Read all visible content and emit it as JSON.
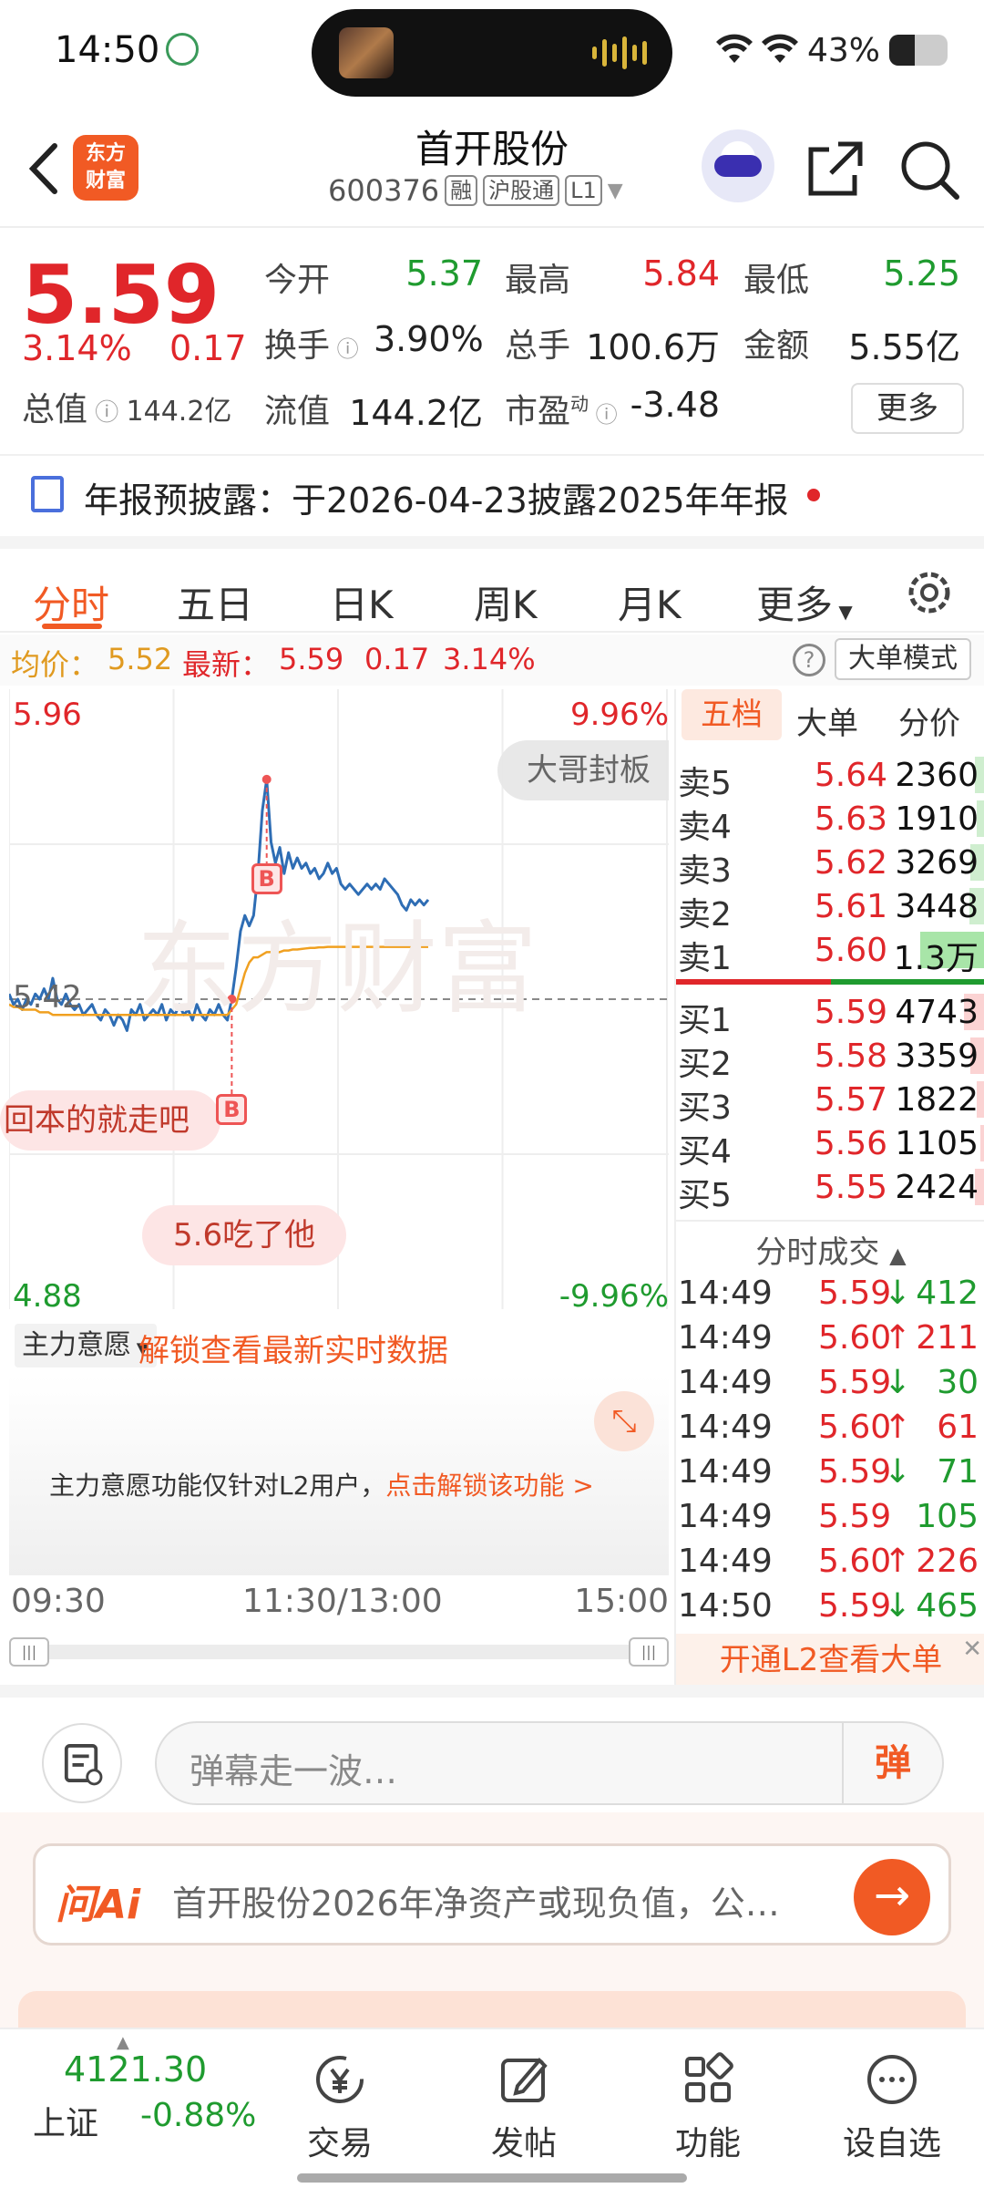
{
  "status_bar": {
    "time": "14:50",
    "battery": "43%",
    "battery_level": 0.43
  },
  "header": {
    "stock_name": "首开股份",
    "stock_code": "600376",
    "tags": [
      "融",
      "沪股通",
      "L1"
    ],
    "logo_text_line1": "东方",
    "logo_text_line2": "财富"
  },
  "quote": {
    "price": "5.59",
    "change_pct": "3.14%",
    "change": "0.17",
    "market_cap_label": "总值",
    "market_cap": "144.2亿",
    "open_label": "今开",
    "open": "5.37",
    "high_label": "最高",
    "high": "5.84",
    "low_label": "最低",
    "low": "5.25",
    "turnover_label": "换手",
    "turnover": "3.90%",
    "volume_label": "总手",
    "volume": "100.6万",
    "amount_label": "金额",
    "amount": "5.55亿",
    "float_cap_label": "流值",
    "float_cap": "144.2亿",
    "pe_label": "市盈",
    "pe_sup": "动",
    "pe": "-3.48",
    "more_label": "更多"
  },
  "notice": {
    "text": "年报预披露：于2026-04-23披露2025年年报"
  },
  "tabs": [
    "分时",
    "五日",
    "日K",
    "周K",
    "月K",
    "更多"
  ],
  "avg_row": {
    "avg_label": "均价：",
    "avg": "5.52",
    "last_label": "最新：",
    "last": "5.59",
    "chg": "0.17",
    "pct": "3.14%",
    "big_mode_label": "大单模式"
  },
  "chart_data": {
    "type": "line",
    "title": "",
    "ylim": [
      4.88,
      5.96
    ],
    "y_tick_labels": {
      "top": "5.96",
      "mid": "5.42",
      "bottom": "4.88"
    },
    "pct_tick_labels": {
      "top": "9.96%",
      "bottom": "-9.96%"
    },
    "prev_close": 5.42,
    "x_tick_labels": [
      "09:30",
      "11:30/13:00",
      "15:00"
    ],
    "series": [
      {
        "values": [
          5.43,
          5.41,
          5.42,
          5.4,
          5.42,
          5.41,
          5.43,
          5.42,
          5.44,
          5.42,
          5.46,
          5.42,
          5.41,
          5.43,
          5.41,
          5.4,
          5.41,
          5.39,
          5.4,
          5.41,
          5.39,
          5.38,
          5.4,
          5.39,
          5.37,
          5.39,
          5.38,
          5.36,
          5.4,
          5.39,
          5.41,
          5.38,
          5.39,
          5.4,
          5.39,
          5.41,
          5.38,
          5.4,
          5.39,
          5.41,
          5.39,
          5.4,
          5.38,
          5.41,
          5.39,
          5.38,
          5.4,
          5.39,
          5.41,
          5.39,
          5.38,
          5.42,
          5.48,
          5.55,
          5.58,
          5.56,
          5.58,
          5.66,
          5.78,
          5.84,
          5.72,
          5.68,
          5.71,
          5.66,
          5.7,
          5.67,
          5.69,
          5.67,
          5.68,
          5.66,
          5.67,
          5.65,
          5.66,
          5.68,
          5.66,
          5.67,
          5.64,
          5.63,
          5.64,
          5.63,
          5.62,
          5.63,
          5.64,
          5.63,
          5.64,
          5.63,
          5.65,
          5.64,
          5.63,
          5.62,
          5.6,
          5.59,
          5.61,
          5.6,
          5.61,
          5.6,
          5.61
        ]
      },
      {
        "values": [
          5.41,
          5.405,
          5.405,
          5.4,
          5.4,
          5.4,
          5.4,
          5.395,
          5.395,
          5.395,
          5.39,
          5.39,
          5.39,
          5.39,
          5.39,
          5.39,
          5.39,
          5.39,
          5.39,
          5.39,
          5.39,
          5.39,
          5.39,
          5.39,
          5.39,
          5.39,
          5.39,
          5.39,
          5.39,
          5.39,
          5.39,
          5.39,
          5.39,
          5.39,
          5.39,
          5.39,
          5.39,
          5.39,
          5.39,
          5.39,
          5.39,
          5.39,
          5.39,
          5.39,
          5.39,
          5.39,
          5.39,
          5.39,
          5.39,
          5.39,
          5.39,
          5.4,
          5.41,
          5.44,
          5.47,
          5.49,
          5.5,
          5.5,
          5.505,
          5.51,
          5.51,
          5.51,
          5.51,
          5.513,
          5.513,
          5.515,
          5.515,
          5.516,
          5.517,
          5.518,
          5.518,
          5.519,
          5.519,
          5.52,
          5.52,
          5.52,
          5.52,
          5.52,
          5.52,
          5.52,
          5.52,
          5.52,
          5.52,
          5.52,
          5.52,
          5.52,
          5.52,
          5.52,
          5.52,
          5.52,
          5.52,
          5.52,
          5.52,
          5.52,
          5.52,
          5.52,
          5.52
        ]
      }
    ],
    "colors": {
      "price": "#2e6db4",
      "average": "#f0a020"
    }
  },
  "danmu": [
    "大哥封板",
    "回本的就走吧",
    "5.6吃了他"
  ],
  "trade_marks": [
    "B",
    "B"
  ],
  "main_force": {
    "select_label": "主力意愿",
    "unlock_text": "解锁查看最新实时数据",
    "msg": "主力意愿功能仅针对L2用户，",
    "msg_link": "点击解锁该功能 >"
  },
  "order_book": {
    "tabs": [
      "五档",
      "大单",
      "分价"
    ],
    "asks": [
      {
        "label": "卖5",
        "price": "5.64",
        "vol": "2360",
        "bar": 0.1
      },
      {
        "label": "卖4",
        "price": "5.63",
        "vol": "1910",
        "bar": 0.08
      },
      {
        "label": "卖3",
        "price": "5.62",
        "vol": "3269",
        "bar": 0.14
      },
      {
        "label": "卖2",
        "price": "5.61",
        "vol": "3448",
        "bar": 0.15
      },
      {
        "label": "卖1",
        "price": "5.60",
        "vol": "1.3万",
        "bar": 0.6
      }
    ],
    "bids": [
      {
        "label": "买1",
        "price": "5.59",
        "vol": "4743",
        "bar": 0.2
      },
      {
        "label": "买2",
        "price": "5.58",
        "vol": "3359",
        "bar": 0.14
      },
      {
        "label": "买3",
        "price": "5.57",
        "vol": "1822",
        "bar": 0.08
      },
      {
        "label": "买4",
        "price": "5.56",
        "vol": "1105",
        "bar": 0.05
      },
      {
        "label": "买5",
        "price": "5.55",
        "vol": "2424",
        "bar": 0.1
      }
    ],
    "ticks_title": "分时成交",
    "ticks": [
      {
        "time": "14:49",
        "price": "5.59",
        "dir": "↓",
        "vol": "412"
      },
      {
        "time": "14:49",
        "price": "5.60",
        "dir": "↑",
        "vol": "211"
      },
      {
        "time": "14:49",
        "price": "5.59",
        "dir": "↓",
        "vol": "30"
      },
      {
        "time": "14:49",
        "price": "5.60",
        "dir": "↑",
        "vol": "61"
      },
      {
        "time": "14:49",
        "price": "5.59",
        "dir": "↓",
        "vol": "71"
      },
      {
        "time": "14:49",
        "price": "5.59",
        "dir": "",
        "vol": "105"
      },
      {
        "time": "14:49",
        "price": "5.60",
        "dir": "↑",
        "vol": "226"
      },
      {
        "time": "14:50",
        "price": "5.59",
        "dir": "↓",
        "vol": "465"
      }
    ],
    "l2_banner": "开通L2查看大单"
  },
  "comment": {
    "placeholder": "弹幕走一波…",
    "danmu_btn": "弹"
  },
  "ask_ai": {
    "logo": "问Ai",
    "text": "首开股份2026年净资产或现负值，公…"
  },
  "bottom_nav": {
    "index_value": "4121.30",
    "index_name": "上证",
    "index_change": "-0.88%",
    "items": [
      "交易",
      "发帖",
      "功能",
      "设自选"
    ]
  }
}
